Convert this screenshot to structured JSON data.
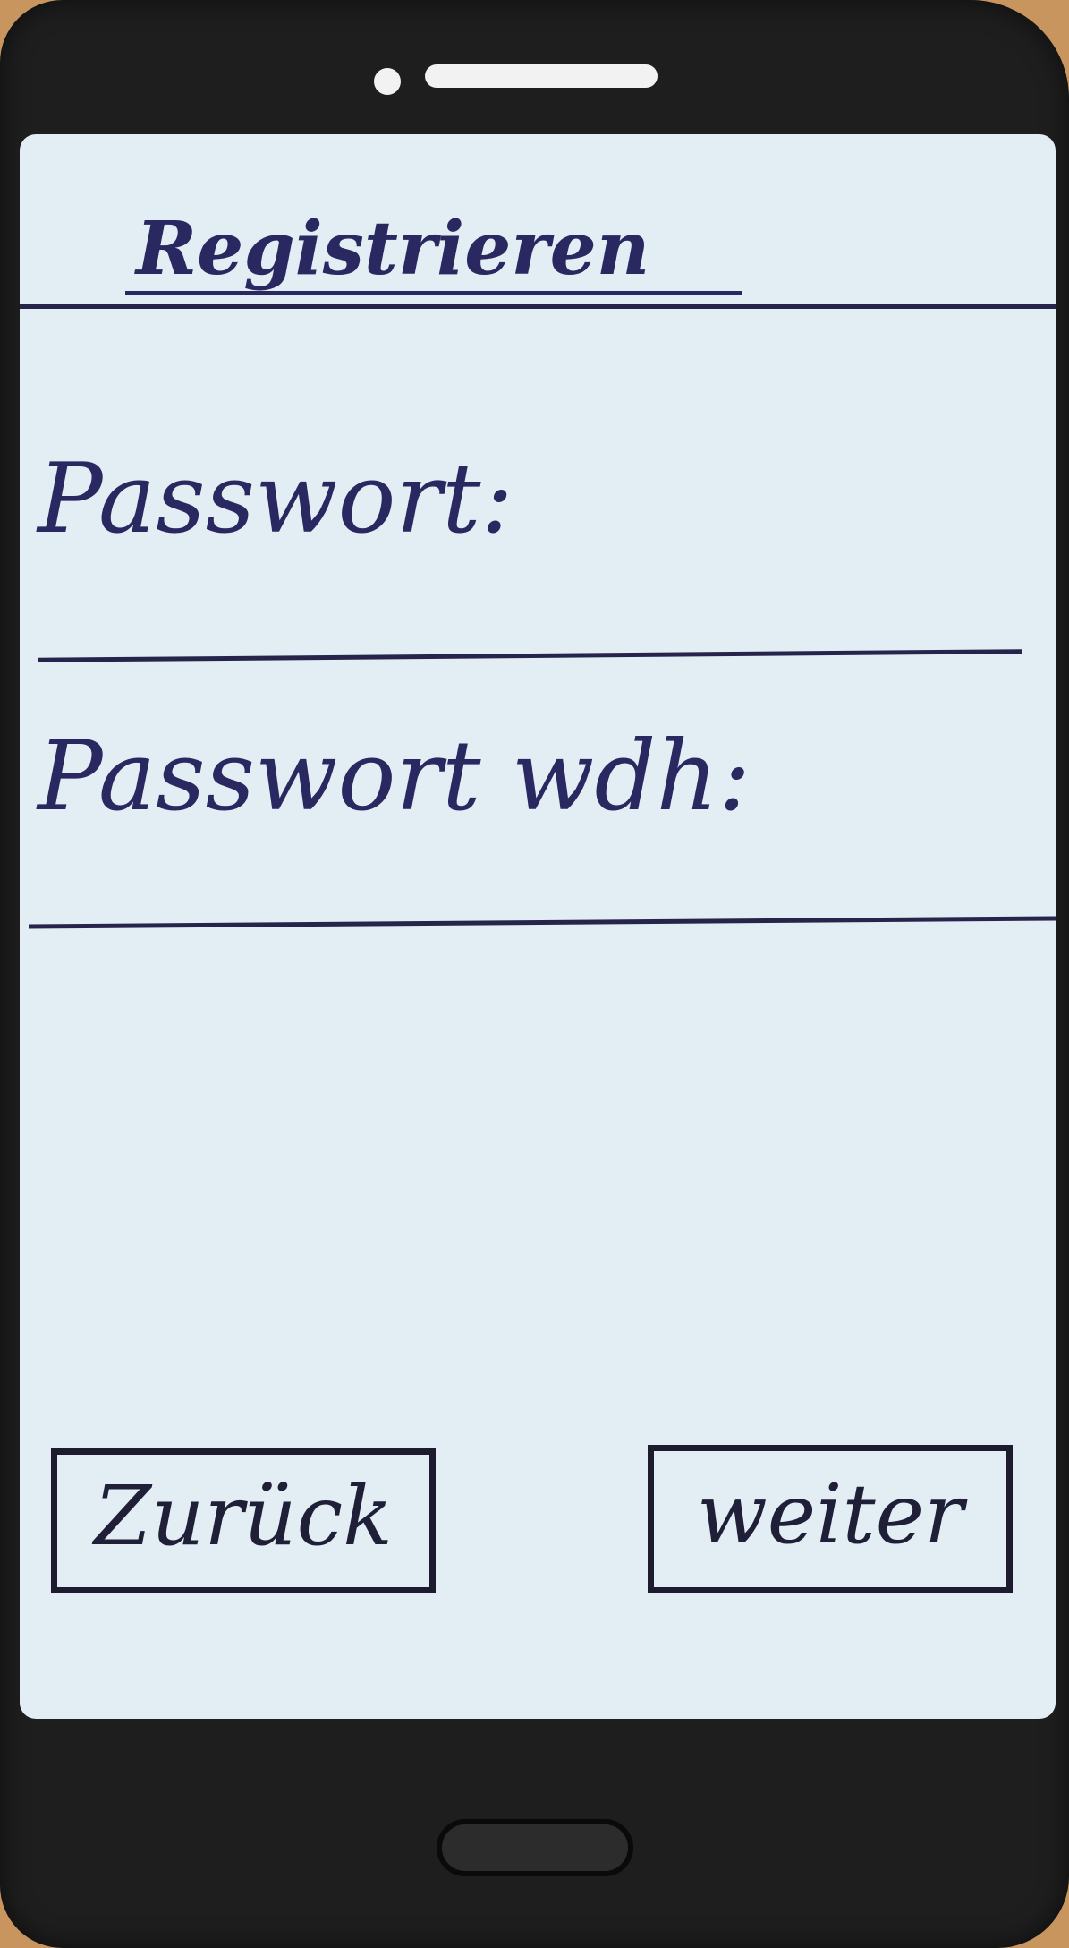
{
  "screen": {
    "title": "Registrieren",
    "fields": [
      {
        "label": "Passwort:",
        "value": ""
      },
      {
        "label": "Passwort wdh:",
        "value": ""
      }
    ]
  },
  "buttons": {
    "back": "Zurück",
    "next": "weiter"
  },
  "colors": {
    "ink": "#2a2860",
    "screen": "#e3edf4",
    "phone_body": "#1e1e1e"
  }
}
